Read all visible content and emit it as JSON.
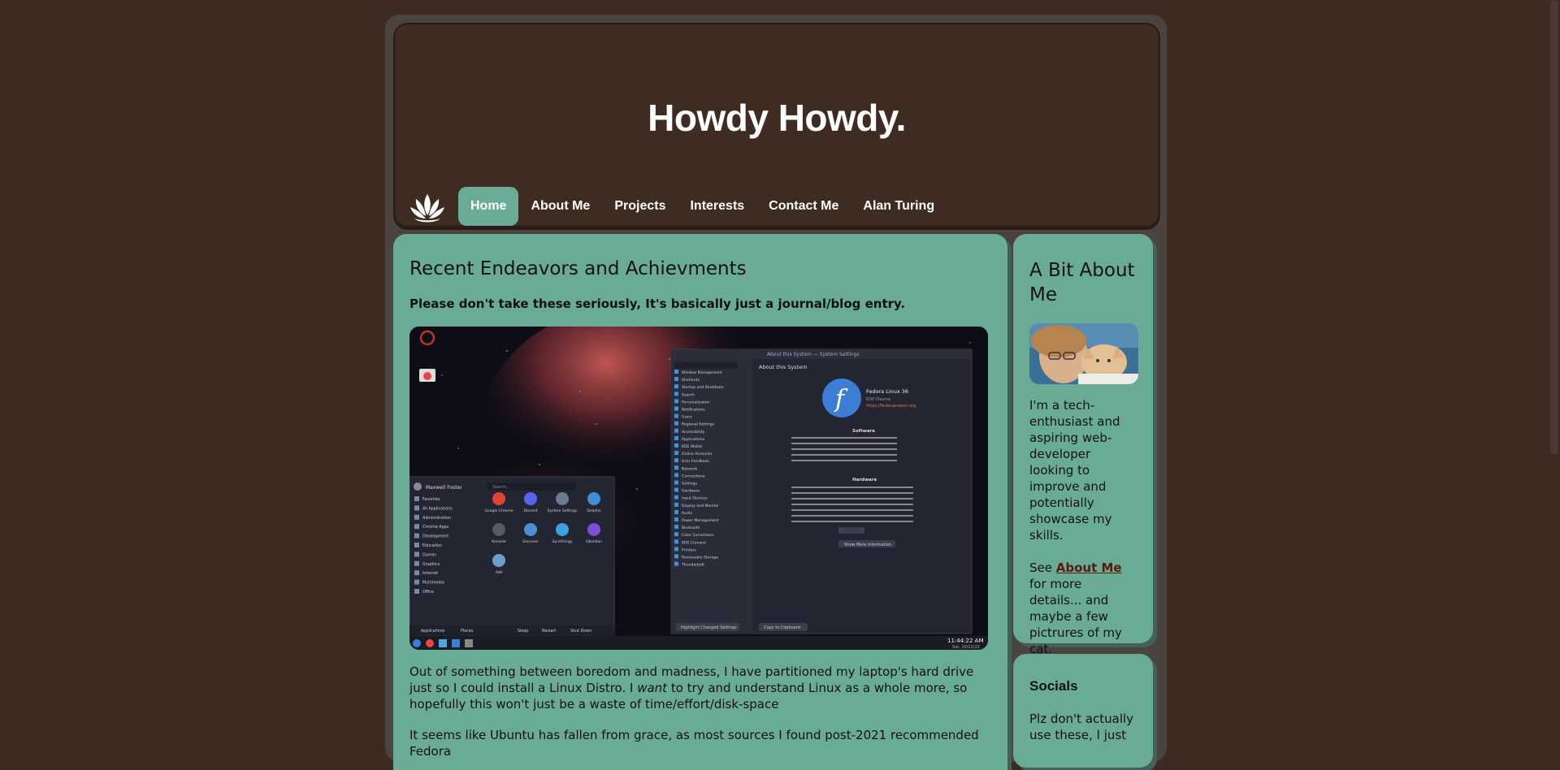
{
  "site": {
    "title": "Howdy Howdy."
  },
  "nav": [
    {
      "label": "Home",
      "active": true
    },
    {
      "label": "About Me"
    },
    {
      "label": "Projects"
    },
    {
      "label": "Interests"
    },
    {
      "label": "Contact Me"
    },
    {
      "label": "Alan Turing"
    }
  ],
  "main": {
    "heading": "Recent Endeavors and Achievments",
    "subheading": "Please don't take these seriously, It's basically just a journal/blog entry.",
    "screenshot": {
      "window_title": "About this System — System Settings",
      "page_title": "About this System",
      "os_name": "Fedora Linux 36",
      "desktop": "KDE Plasma",
      "website": "https://fedoraproject.org",
      "software_heading": "Software",
      "hardware_heading": "Hardware",
      "show_more": "Show More Information",
      "highlight": "Highlight Changed Settings",
      "copy": "Copy to Clipboard",
      "clock": "11:44:22 AM",
      "date": "Sat, 10/22/22",
      "menu_user": "Maxwell Foster",
      "menu_search": "Search...",
      "menu_categories": [
        "Favorites",
        "All Applications",
        "Administration",
        "Chrome Apps",
        "Development",
        "Education",
        "Games",
        "Graphics",
        "Internet",
        "Multimedia",
        "Office"
      ],
      "menu_apps": [
        "Google Chrome",
        "Discord",
        "System Settings",
        "Dolphin",
        "Konsole",
        "Discover",
        "Syncthingy",
        "Obsidian",
        "Add"
      ],
      "menu_footer": [
        "Applications",
        "Places",
        "Sleep",
        "Restart",
        "Shut Down"
      ],
      "settings_items": [
        "Window Management",
        "Shortcuts",
        "Startup and Shutdown",
        "Search",
        "Personalization",
        "Notifications",
        "Users",
        "Regional Settings",
        "Accessibility",
        "Applications",
        "KDE Wallet",
        "Online Accounts",
        "User Feedback",
        "Network",
        "Connections",
        "Settings",
        "Hardware",
        "Input Devices",
        "Display and Monitor",
        "Audio",
        "Power Management",
        "Bluetooth",
        "Color Corrections",
        "KDE Connect",
        "Printers",
        "Removable Storage",
        "Thunderbolt"
      ]
    },
    "paragraph1_a": "Out of something between boredom and madness, I have partitioned my laptop's hard drive just so I could install a Linux Distro. I ",
    "paragraph1_em": "want",
    "paragraph1_b": " to try and understand Linux as a whole more, so hopefully this won't just be a waste of time/effort/disk-space",
    "paragraph2": "It seems like Ubuntu has fallen from grace, as most sources I found post-2021 recommended Fedora"
  },
  "about": {
    "heading": "A Bit About Me",
    "text": "I'm a tech-enthusiast and aspiring web-developer looking to improve and potentially showcase my skills.",
    "see": "See ",
    "link": "About Me",
    "rest": " for more details... and maybe a few pictrures of my cat."
  },
  "socials": {
    "heading": "Socials",
    "text": "Plz don't actually use these, I just"
  },
  "colors": {
    "background": "#3d2b22",
    "accent": "#6aab95"
  }
}
